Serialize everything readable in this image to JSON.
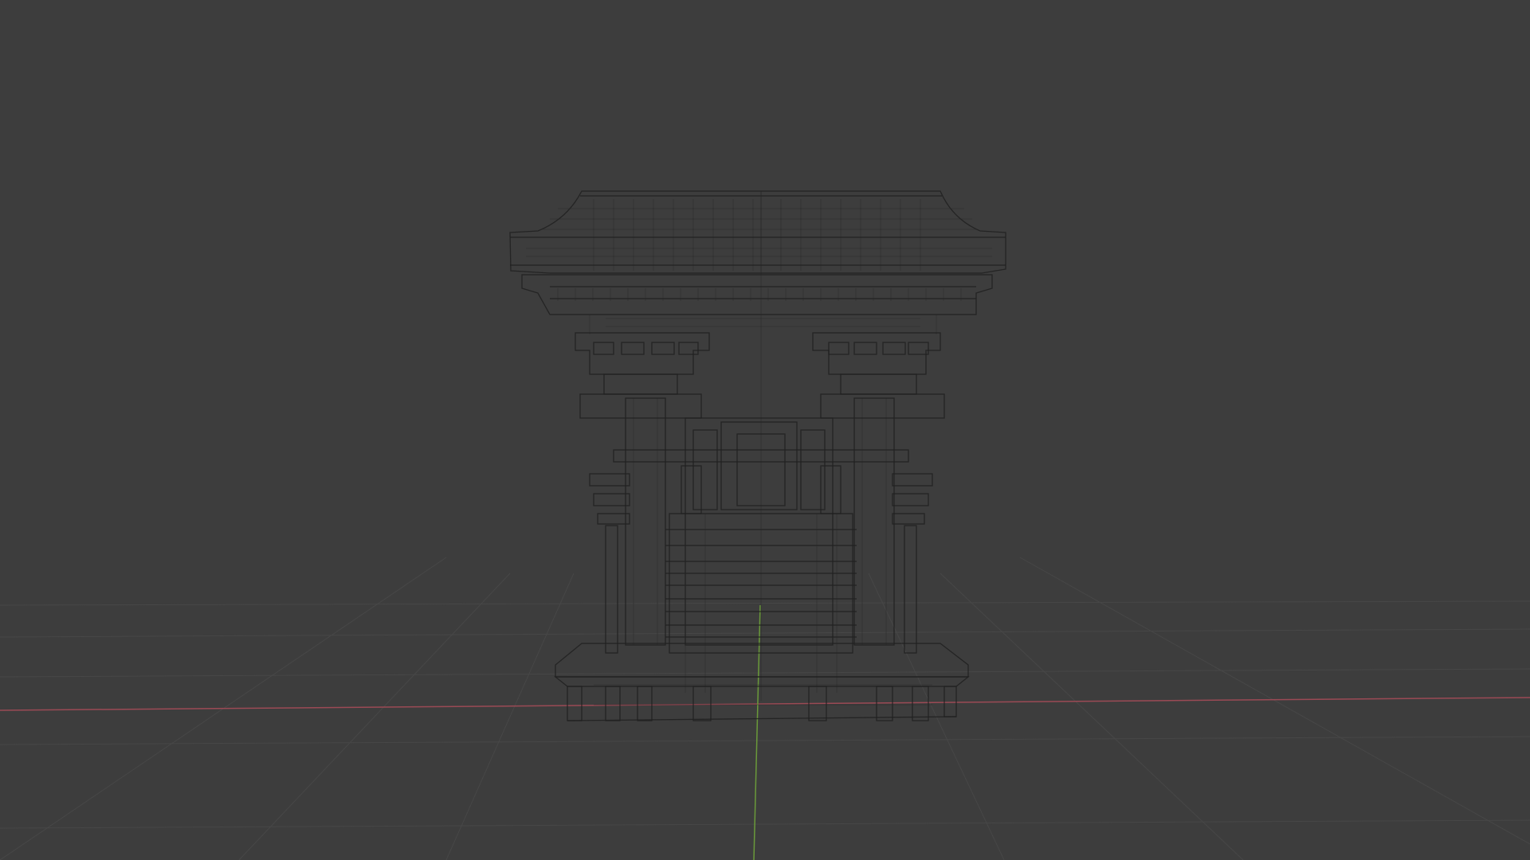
{
  "viewport": {
    "background_color": "#3d3d3d",
    "grid_color": "#474747",
    "wire_color": "#202020",
    "axis_x_color": "#9b4a55",
    "axis_y_color": "#6a9a3a",
    "shading_mode": "wireframe",
    "object": "shrine-gate"
  }
}
